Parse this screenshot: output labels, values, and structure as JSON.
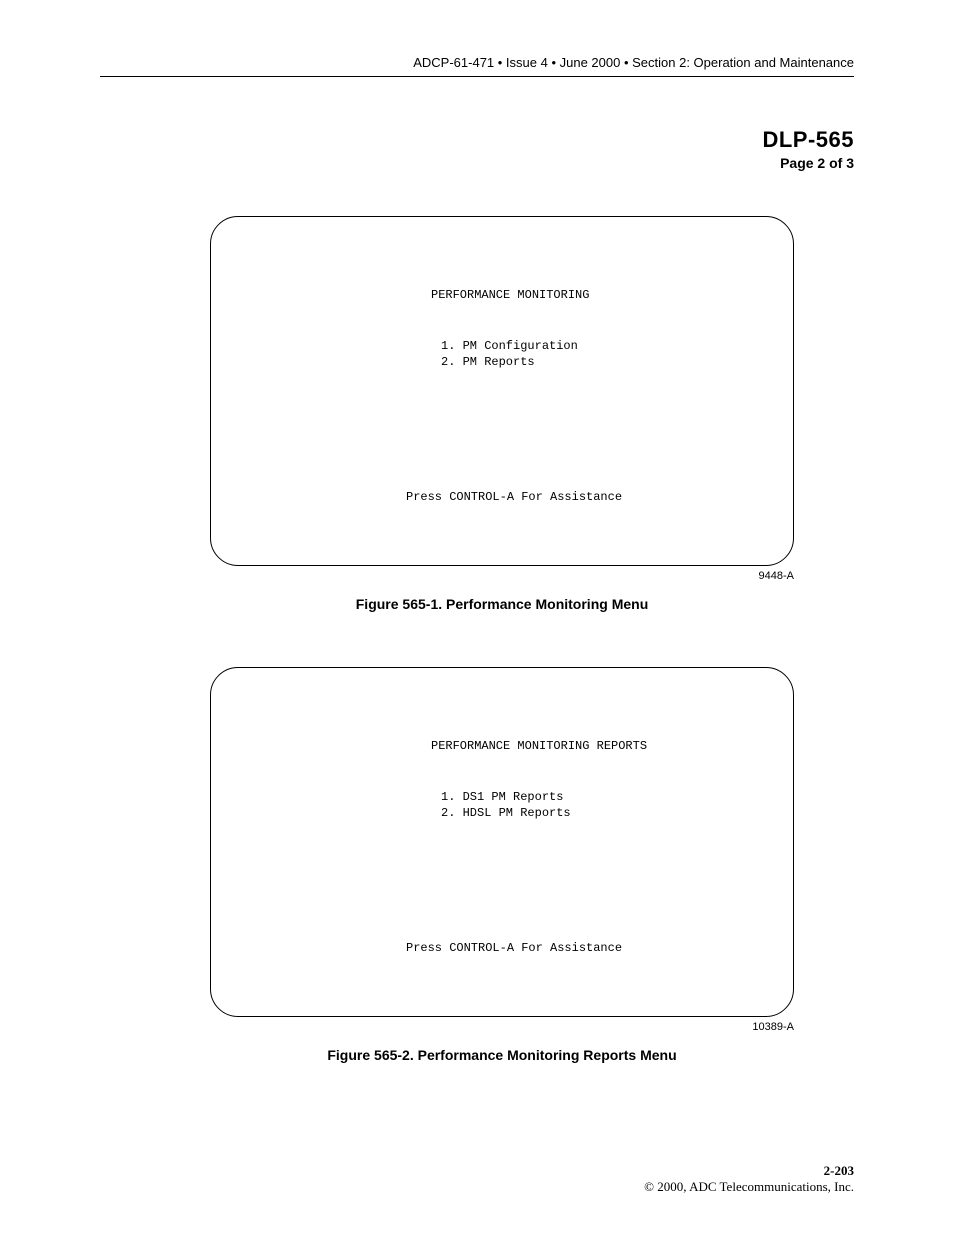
{
  "header": {
    "breadcrumb": "ADCP-61-471 • Issue 4 • June 2000 • Section 2: Operation and Maintenance"
  },
  "doc_id_block": {
    "id": "DLP-565",
    "page_of": "Page 2 of 3"
  },
  "figures": [
    {
      "terminal": {
        "title": "PERFORMANCE MONITORING",
        "options": [
          "1. PM Configuration",
          "2. PM Reports"
        ],
        "footer": "Press CONTROL-A For Assistance"
      },
      "ref": "9448-A",
      "caption": "Figure 565-1. Performance Monitoring Menu"
    },
    {
      "terminal": {
        "title": "PERFORMANCE MONITORING REPORTS",
        "options": [
          "1. DS1 PM Reports",
          "2. HDSL PM Reports"
        ],
        "footer": "Press CONTROL-A For Assistance"
      },
      "ref": "10389-A",
      "caption": "Figure 565-2. Performance Monitoring Reports Menu"
    }
  ],
  "footer": {
    "page_number": "2-203",
    "copyright": "© 2000, ADC Telecommunications, Inc."
  }
}
